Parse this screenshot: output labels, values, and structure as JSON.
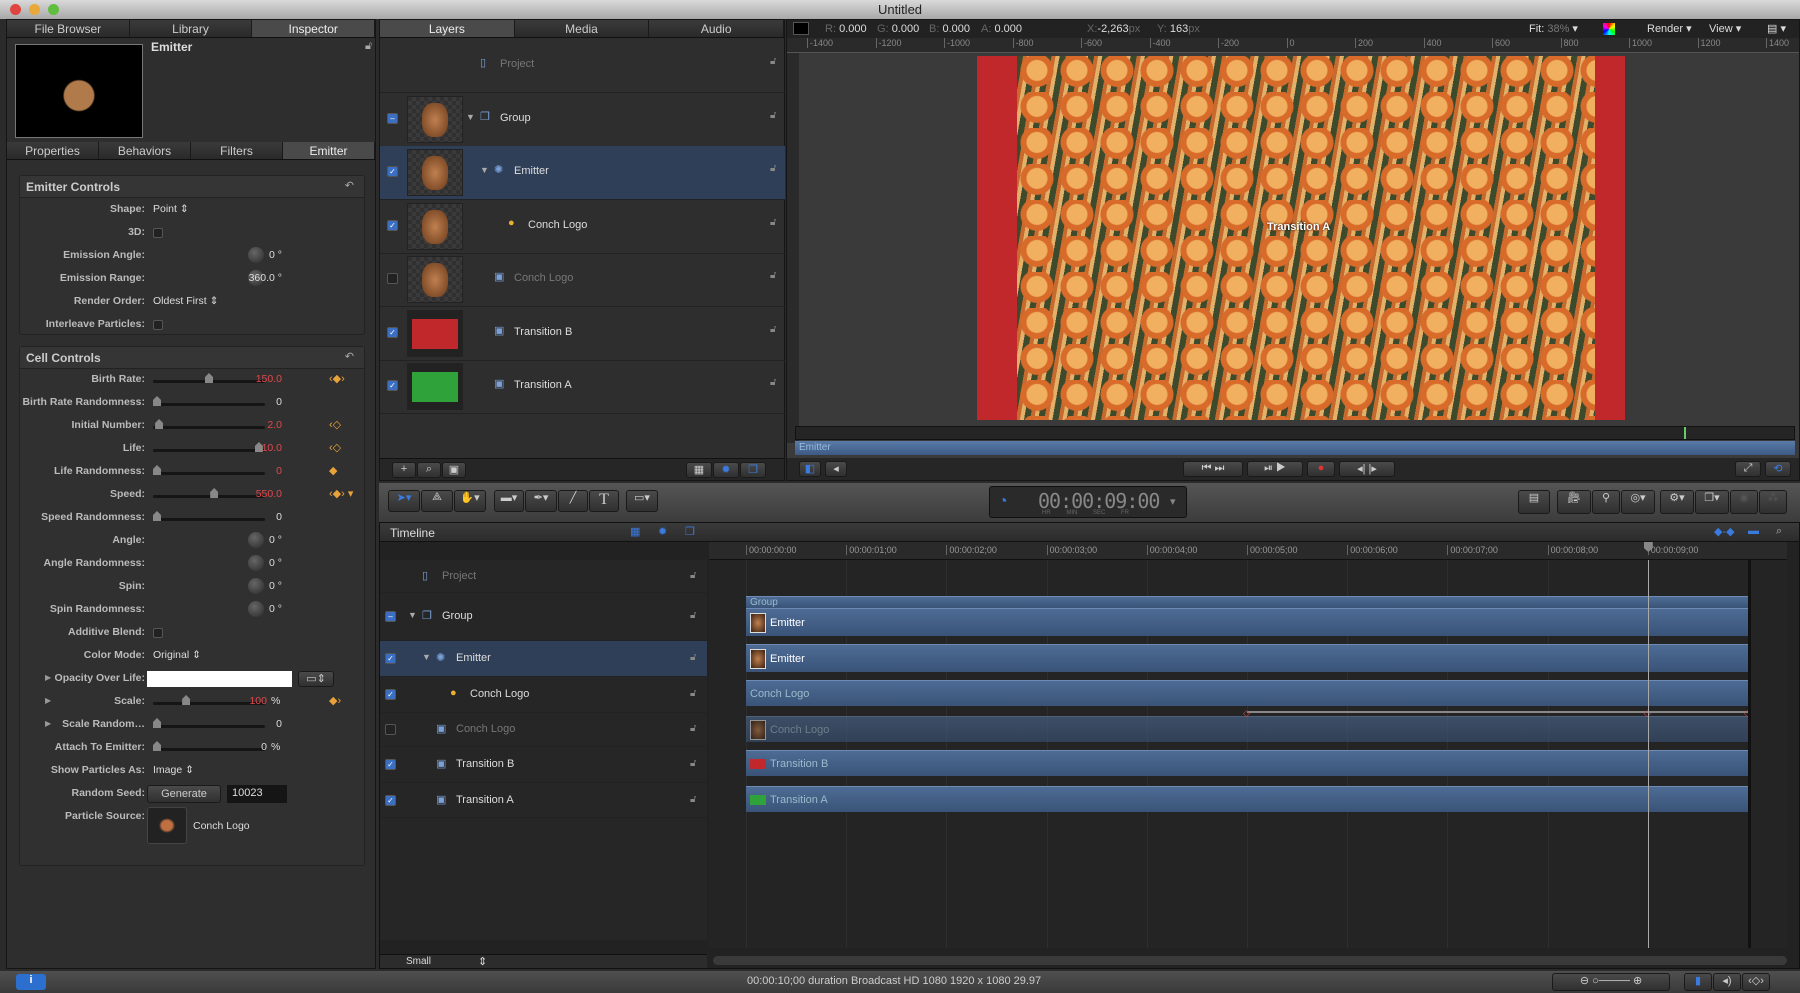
{
  "window": {
    "title": "Untitled"
  },
  "left_tabs": [
    "File Browser",
    "Library",
    "Inspector"
  ],
  "inspector": {
    "object_name": "Emitter",
    "tabs": [
      "Properties",
      "Behaviors",
      "Filters",
      "Emitter"
    ],
    "emitter_controls": {
      "title": "Emitter Controls",
      "rows": [
        {
          "label": "Shape:",
          "type": "popup",
          "value": "Point"
        },
        {
          "label": "3D:",
          "type": "checkbox",
          "checked": false
        },
        {
          "label": "Emission Angle:",
          "type": "dial",
          "value": "0 °"
        },
        {
          "label": "Emission Range:",
          "type": "dial",
          "value": "360.0 °"
        },
        {
          "label": "Render Order:",
          "type": "popup",
          "value": "Oldest First"
        },
        {
          "label": "Interleave Particles:",
          "type": "checkbox",
          "checked": false
        }
      ]
    },
    "cell_controls": {
      "title": "Cell Controls",
      "rows": [
        {
          "label": "Birth Rate:",
          "type": "slider",
          "value": "150.0",
          "pos": 0.5,
          "animated": true,
          "kf": "‹◆›"
        },
        {
          "label": "Birth Rate Randomness:",
          "type": "slider",
          "value": "0",
          "pos": 0
        },
        {
          "label": "Initial Number:",
          "type": "slider",
          "value": "2.0",
          "pos": 0.02,
          "animated": true,
          "kf": "‹◇"
        },
        {
          "label": "Life:",
          "type": "slider",
          "value": "10.0",
          "pos": 0.98,
          "animated": true,
          "kf": "‹◇"
        },
        {
          "label": "Life Randomness:",
          "type": "slider",
          "value": "0",
          "pos": 0,
          "animated": true,
          "kf": "◆"
        },
        {
          "label": "Speed:",
          "type": "slider",
          "value": "550.0",
          "pos": 0.55,
          "animated": true,
          "kf": "‹◆› ▾"
        },
        {
          "label": "Speed Randomness:",
          "type": "slider",
          "value": "0",
          "pos": 0
        },
        {
          "label": "Angle:",
          "type": "dial",
          "value": "0 °"
        },
        {
          "label": "Angle Randomness:",
          "type": "dial",
          "value": "0 °"
        },
        {
          "label": "Spin:",
          "type": "dial",
          "value": "0 °"
        },
        {
          "label": "Spin Randomness:",
          "type": "dial",
          "value": "0 °"
        },
        {
          "label": "Additive Blend:",
          "type": "checkbox",
          "checked": false
        },
        {
          "label": "Color Mode:",
          "type": "popup",
          "value": "Original"
        },
        {
          "label": "Opacity Over Life:",
          "type": "gradient",
          "disclosure": true
        },
        {
          "label": "Scale:",
          "type": "slider",
          "value": "100",
          "unit": "%",
          "pos": 0.28,
          "animated": true,
          "kf": "◆›",
          "disclosure": true
        },
        {
          "label": "Scale Random…",
          "type": "slider",
          "value": "0",
          "pos": 0,
          "disclosure": true
        },
        {
          "label": "Attach To Emitter:",
          "type": "slider",
          "value": "0",
          "unit": "%",
          "pos": 0
        },
        {
          "label": "Show Particles As:",
          "type": "popup",
          "value": "Image"
        },
        {
          "label": "Random Seed:",
          "type": "seed",
          "button": "Generate",
          "value": "10023"
        },
        {
          "label": "Particle Source:",
          "type": "source",
          "value": "Conch Logo"
        }
      ]
    }
  },
  "layers_tabs": [
    "Layers",
    "Media",
    "Audio"
  ],
  "layers": [
    {
      "name": "Project",
      "icon": "document-icon",
      "check": null,
      "indent": 0
    },
    {
      "name": "Group",
      "icon": "group-icon",
      "check": "mixed",
      "indent": 0,
      "disclosure": true
    },
    {
      "name": "Emitter",
      "icon": "emitter-icon",
      "check": true,
      "indent": 1,
      "disclosure": true,
      "selected": true
    },
    {
      "name": "Conch Logo",
      "icon": "particle-cell-icon",
      "check": true,
      "indent": 2
    },
    {
      "name": "Conch Logo",
      "icon": "image-icon",
      "check": false,
      "indent": 1,
      "dim": true
    },
    {
      "name": "Transition B",
      "icon": "image-icon",
      "check": true,
      "indent": 1,
      "thumb": "#c0282c"
    },
    {
      "name": "Transition A",
      "icon": "image-icon",
      "check": true,
      "indent": 1,
      "thumb": "#2fa23a"
    }
  ],
  "canvas": {
    "r": "0.000",
    "g": "0.000",
    "b": "0.000",
    "a": "0.000",
    "x": "-2,263",
    "y": "163",
    "unit": "px",
    "fit": "Fit:",
    "fit_value": "38%",
    "render": "Render",
    "view": "View",
    "ruler": [
      "-1400",
      "-1200",
      "-1000",
      "-800",
      "-600",
      "-400",
      "-200",
      "0",
      "200",
      "400",
      "600",
      "800",
      "1000",
      "1200",
      "1400"
    ],
    "overlay_label": "Transition A",
    "mini_timeline_label": "Emitter"
  },
  "timecode": {
    "value": "00:00:09:00",
    "units": [
      "HR",
      "MIN",
      "SEC",
      "FR"
    ]
  },
  "timeline": {
    "title": "Timeline",
    "ruler": [
      "00:00:00:00",
      "00:00:01;00",
      "00:00:02;00",
      "00:00:03;00",
      "00:00:04;00",
      "00:00:05;00",
      "00:00:06;00",
      "00:00:07;00",
      "00:00:08;00",
      "00:00:09;00"
    ],
    "playhead_seconds": 9,
    "duration_seconds": 10,
    "rows": [
      "Project",
      "Group",
      "Emitter",
      "Conch Logo",
      "Conch Logo",
      "Transition B",
      "Transition A"
    ],
    "clips": [
      {
        "label": "Group",
        "start": 0,
        "end": 10
      },
      {
        "label": "Emitter",
        "start": 0,
        "end": 10
      },
      {
        "label": "Emitter",
        "start": 0,
        "end": 10
      },
      {
        "label": "Conch Logo",
        "start": 0,
        "end": 10
      },
      {
        "label": "Conch Logo",
        "start": 0,
        "end": 10
      },
      {
        "label": "Transition B",
        "start": 0,
        "end": 10
      },
      {
        "label": "Transition A",
        "start": 0,
        "end": 10
      }
    ],
    "keyframes_seconds": [
      5,
      9,
      10
    ],
    "size_popup": "Small"
  },
  "status": {
    "text": "00:00:10;00 duration Broadcast HD 1080 1920 x 1080 29.97"
  },
  "colors": {
    "accent": "#3a7be0",
    "clip": "#4d6b94",
    "selection": "#2f3f58",
    "keyframe": "#e8a23a",
    "animated_value": "#e0484d"
  }
}
